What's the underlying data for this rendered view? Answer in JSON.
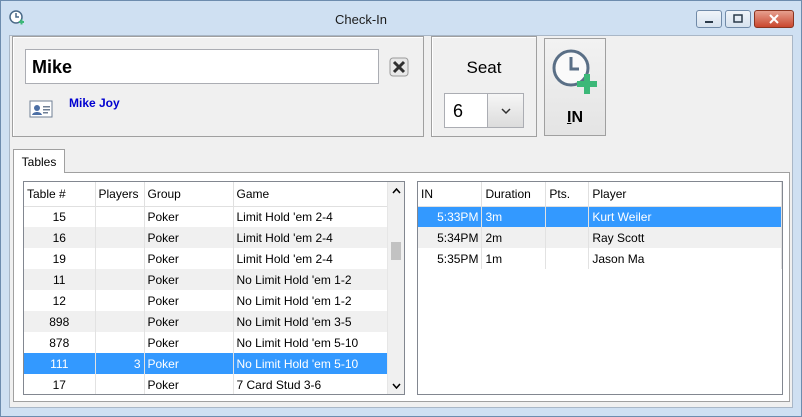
{
  "window": {
    "title": "Check-In"
  },
  "player": {
    "name_value": "Mike",
    "member_name": "Mike Joy"
  },
  "seat": {
    "label": "Seat",
    "value": "6"
  },
  "checkin_button": {
    "label_underlined": "I",
    "label_rest": "N"
  },
  "tabs": [
    {
      "label": "Tables"
    }
  ],
  "tables_grid": {
    "columns": [
      "Table #",
      "Players",
      "Group",
      "Game"
    ],
    "rows": [
      {
        "table": "15",
        "players": "",
        "group": "Poker",
        "game": "Limit Hold 'em 2-4"
      },
      {
        "table": "16",
        "players": "",
        "group": "Poker",
        "game": "Limit Hold 'em 2-4"
      },
      {
        "table": "19",
        "players": "",
        "group": "Poker",
        "game": "Limit Hold 'em 2-4"
      },
      {
        "table": "11",
        "players": "",
        "group": "Poker",
        "game": "No Limit Hold 'em 1-2"
      },
      {
        "table": "12",
        "players": "",
        "group": "Poker",
        "game": "No Limit Hold 'em 1-2"
      },
      {
        "table": "898",
        "players": "",
        "group": "Poker",
        "game": "No Limit Hold 'em 3-5"
      },
      {
        "table": "878",
        "players": "",
        "group": "Poker",
        "game": "No Limit Hold 'em 5-10"
      },
      {
        "table": "111",
        "players": "3",
        "group": "Poker",
        "game": "No Limit Hold 'em 5-10"
      },
      {
        "table": "17",
        "players": "",
        "group": "Poker",
        "game": "7 Card Stud 3-6"
      }
    ],
    "selected_row": 7
  },
  "players_grid": {
    "columns": [
      "IN",
      "Duration",
      "Pts.",
      "Player"
    ],
    "rows": [
      {
        "in": "5:33PM",
        "duration": "3m",
        "pts": "",
        "player": "Kurt Weiler"
      },
      {
        "in": "5:34PM",
        "duration": "2m",
        "pts": "",
        "player": "Ray Scott"
      },
      {
        "in": "5:35PM",
        "duration": "1m",
        "pts": "",
        "player": "Jason Ma"
      }
    ],
    "selected_row": 0
  },
  "colors": {
    "selection": "#3399ff",
    "link": "#0000d0",
    "accent_green": "#3cb878"
  },
  "icons": [
    "clock-app-icon",
    "clear-x-icon",
    "member-card-icon",
    "chevron-down-icon",
    "clock-plus-icon"
  ]
}
